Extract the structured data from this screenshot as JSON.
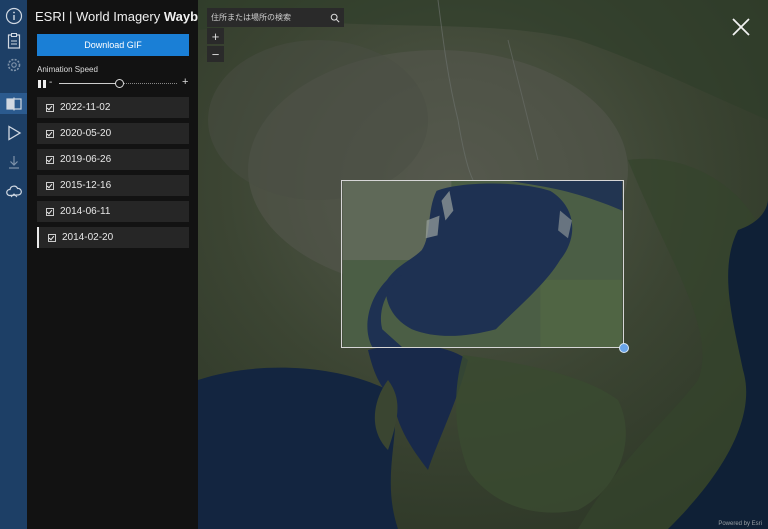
{
  "app": {
    "title_prefix": "ESRI | World Imagery ",
    "title_bold": "Wayback"
  },
  "rail": {
    "icons": [
      "info-icon",
      "clipboard-icon",
      "gear-icon",
      "swipe-icon",
      "play-icon",
      "download-icon",
      "cloud-icon"
    ],
    "selected": "swipe-icon"
  },
  "panel": {
    "download_label": "Download GIF",
    "speed_label": "Animation Speed",
    "speed_minus": "-",
    "speed_plus": "+",
    "speed_level": 0.5,
    "releases": [
      {
        "date": "2022-11-02",
        "checked": true,
        "active": false
      },
      {
        "date": "2020-05-20",
        "checked": true,
        "active": false
      },
      {
        "date": "2019-06-26",
        "checked": true,
        "active": false
      },
      {
        "date": "2015-12-16",
        "checked": true,
        "active": false
      },
      {
        "date": "2014-06-11",
        "checked": true,
        "active": false
      },
      {
        "date": "2014-02-20",
        "checked": true,
        "active": true
      }
    ]
  },
  "map": {
    "search_placeholder": "住所または場所の検索",
    "zoom_in": "+",
    "zoom_out": "−",
    "credit": "Powered by Esri"
  },
  "colors": {
    "accent": "#1a7fd6",
    "rail": "#1d3f66",
    "panel": "#121212",
    "item": "#262626",
    "water": "#1e3152",
    "land": "#3a4430"
  }
}
